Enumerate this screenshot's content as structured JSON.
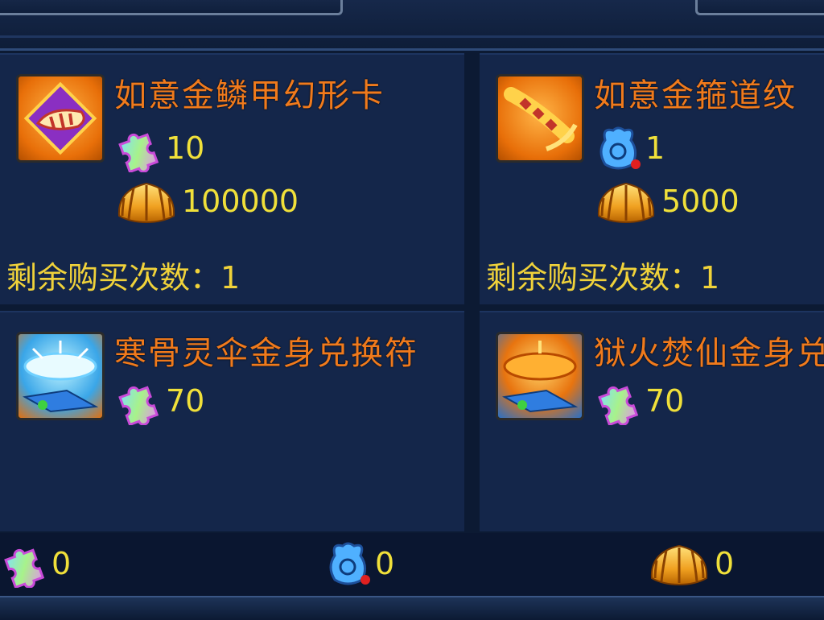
{
  "items": [
    {
      "name": "如意金鳞甲幻形卡",
      "icon": "golden-conch-card-icon",
      "costs": [
        {
          "icon": "puzzle-piece-icon",
          "value": "10"
        },
        {
          "icon": "golden-shell-icon",
          "value": "100000"
        }
      ],
      "remaining": "剩余购买次数：1"
    },
    {
      "name": "如意金箍道纹",
      "icon": "golden-staff-icon",
      "costs": [
        {
          "icon": "blue-pouch-icon",
          "value": "1"
        },
        {
          "icon": "golden-shell-icon",
          "value": "5000"
        }
      ],
      "remaining": "剩余购买次数：1"
    },
    {
      "name": "寒骨灵伞金身兑换符",
      "icon": "ice-umbrella-icon",
      "costs": [
        {
          "icon": "puzzle-piece-icon",
          "value": "70"
        }
      ],
      "remaining": ""
    },
    {
      "name": "狱火焚仙金身兑",
      "icon": "fire-umbrella-icon",
      "costs": [
        {
          "icon": "puzzle-piece-icon",
          "value": "70"
        }
      ],
      "remaining": ""
    }
  ],
  "currencies": [
    {
      "icon": "puzzle-piece-icon",
      "value": "0"
    },
    {
      "icon": "blue-pouch-icon",
      "value": "0"
    },
    {
      "icon": "golden-shell-icon",
      "value": "0"
    }
  ],
  "colors": {
    "name": "#f07a1c",
    "value": "#f0e03a",
    "panel": "#14264a",
    "background": "#0c1a33"
  }
}
